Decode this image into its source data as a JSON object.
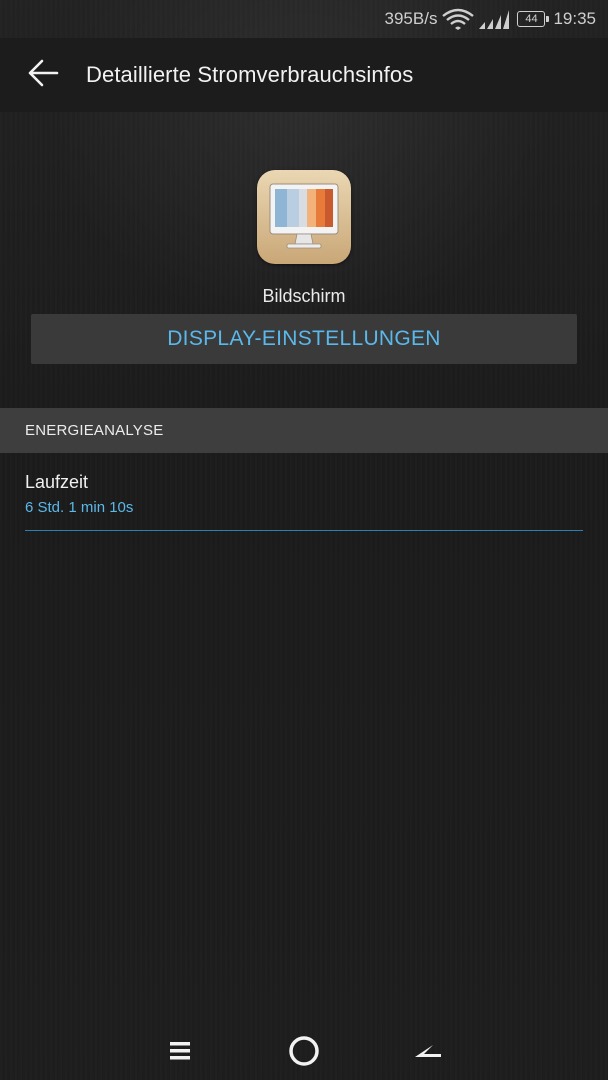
{
  "status_bar": {
    "net_speed": "395B/s",
    "battery_level": "44",
    "time": "19:35",
    "icons": [
      "wifi-icon",
      "signal-icon",
      "battery-icon"
    ]
  },
  "app_bar": {
    "back_icon": "arrow-left-icon",
    "title": "Detaillierte Stromverbrauchsinfos"
  },
  "app_info": {
    "icon": "display-monitor-icon",
    "name": "Bildschirm",
    "settings_button_label": "DISPLAY-EINSTELLUNGEN"
  },
  "energy_section": {
    "header": "ENERGIEANALYSE",
    "items": [
      {
        "title": "Laufzeit",
        "value": "6 Std. 1 min 10s"
      }
    ]
  },
  "nav_bar": {
    "icons": [
      "menu-icon",
      "home-icon",
      "back-icon"
    ]
  },
  "colors": {
    "accent": "#5bb8ea",
    "background": "#1c1c1c",
    "section_header_bg": "#3e3e3e",
    "button_bg": "#3a3a3a",
    "divider": "#2c7fae"
  }
}
